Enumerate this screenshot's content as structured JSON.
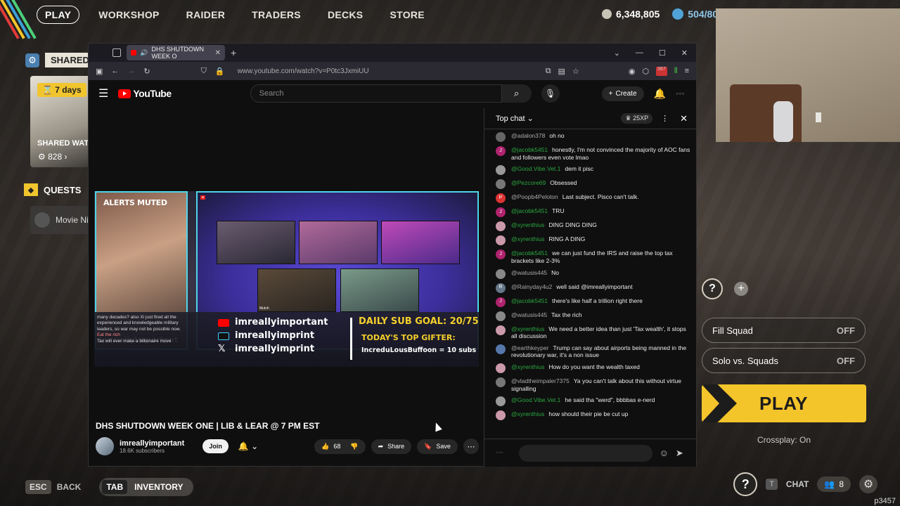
{
  "game": {
    "nav": [
      "PLAY",
      "WORKSHOP",
      "RAIDER",
      "TRADERS",
      "DECKS",
      "STORE"
    ],
    "coins": "6,348,805",
    "tokens": "504/80",
    "shared_label": "SHARED W",
    "days_left": "7 days",
    "shared_watch": "SHARED WAT",
    "shared_count": "828",
    "quests_label": "QUESTS",
    "movie_label": "Movie Ni",
    "bottom": {
      "esc_key": "ESC",
      "back": "BACK",
      "tab_key": "TAB",
      "inventory": "INVENTORY"
    },
    "chat_key": "T",
    "chat_label": "CHAT",
    "friends_count": "8",
    "squad": {
      "fill_squad": "Fill Squad",
      "fill_squad_value": "OFF",
      "solo_vs": "Solo vs. Squads",
      "solo_vs_value": "OFF",
      "play": "PLAY",
      "crossplay": "Crossplay: On"
    },
    "watermark": "p3457"
  },
  "browser": {
    "tab_title": "DHS SHUTDOWN WEEK O",
    "url": "www.youtube.com/watch?v=P0tc3JxmiUU",
    "badge": "367"
  },
  "youtube": {
    "logo": "YouTube",
    "search_placeholder": "Search",
    "create": "Create"
  },
  "video": {
    "alerts": "ALERTS MUTED",
    "streamer": "imreallyimportant",
    "yt_handle": "imreallyimportant",
    "tiktok_handle": "imreallyimprint",
    "x_handle": "imreallyimprint",
    "sub_goal": "DAILY SUB GOAL: 20/75",
    "top_gifter_label": "TODAY'S TOP GIFTER:",
    "top_gifter": "IncreduLousBuffoon = 10 subs",
    "ticker_chat": "many decades? also Xi just fired all the experienced and knowledgeable military leaders, so war may not be possible now.",
    "ticker_line2": "Eat the rich",
    "ticker_line3": "Tax will ever make a billionaire move",
    "tile_label": "Mutch"
  },
  "meta": {
    "title": "DHS SHUTDOWN WEEK ONE | LIB & LEAR @ 7 PM EST",
    "channel": "imreallyimportant",
    "subs": "18.6K subscribers",
    "join": "Join",
    "likes": "68",
    "share": "Share",
    "save": "Save"
  },
  "chat": {
    "header": "Top chat",
    "xp": "25XP",
    "messages": [
      {
        "author": "@adalon378",
        "text": "oh no",
        "av": "",
        "color": "#666",
        "green": false
      },
      {
        "author": "@jacobk5451",
        "text": "honestly, I'm not convinced the majority of AOC fans and followers even vote lmao",
        "av": "J",
        "color": "#b0236e",
        "green": true
      },
      {
        "author": "@Good.Vibe.Vet.1",
        "text": "dem it pisc",
        "av": "",
        "color": "#999",
        "green": true
      },
      {
        "author": "@Pezcore69",
        "text": "Obsessed",
        "av": "",
        "color": "#777",
        "green": true
      },
      {
        "author": "@Poopb4Peloton",
        "text": "Last subject. Pisco can't talk.",
        "av": "P",
        "color": "#d33",
        "green": false
      },
      {
        "author": "@jacobk5451",
        "text": "TRU",
        "av": "J",
        "color": "#b0236e",
        "green": true
      },
      {
        "author": "@xyrenthius",
        "text": "DING DING DING",
        "av": "",
        "color": "#c9a",
        "green": true
      },
      {
        "author": "@xyrenthius",
        "text": "RING A DING",
        "av": "",
        "color": "#c9a",
        "green": true
      },
      {
        "author": "@jacobk5451",
        "text": "we can just fund the IRS and raise the top tax brackets like 2-3%",
        "av": "J",
        "color": "#b0236e",
        "green": true
      },
      {
        "author": "@watusis445",
        "text": "No",
        "av": "",
        "color": "#888",
        "green": false
      },
      {
        "author": "@Rainyday4u2",
        "text": "well said @imreallyimportant",
        "av": "R",
        "color": "#678",
        "green": false
      },
      {
        "author": "@jacobk5451",
        "text": "there's like half a trillion right there",
        "av": "J",
        "color": "#b0236e",
        "green": true
      },
      {
        "author": "@watusis445",
        "text": "Tax the rich",
        "av": "",
        "color": "#888",
        "green": false
      },
      {
        "author": "@xyrenthius",
        "text": "We need a better idea than just 'Tax wealth', it stops all discussion",
        "av": "",
        "color": "#c9a",
        "green": true
      },
      {
        "author": "@earthkeyper",
        "text": "Trump can say about airports being manned in the revolutionary war, it's a non issue",
        "av": "",
        "color": "#57a",
        "green": false
      },
      {
        "author": "@xyrenthius",
        "text": "How do you want the wealth taxed",
        "av": "",
        "color": "#c9a",
        "green": true
      },
      {
        "author": "@vladtheimpaler7375",
        "text": "Ya you can't talk about this without virtue signalling",
        "av": "",
        "color": "#777",
        "green": false
      },
      {
        "author": "@Good.Vibe.Vet.1",
        "text": "he said tha \"werd\", bbbbas e-nerd",
        "av": "",
        "color": "#999",
        "green": true
      },
      {
        "author": "@xyrenthius",
        "text": "how should their pie be cut up",
        "av": "",
        "color": "#c9a",
        "green": true
      }
    ]
  }
}
